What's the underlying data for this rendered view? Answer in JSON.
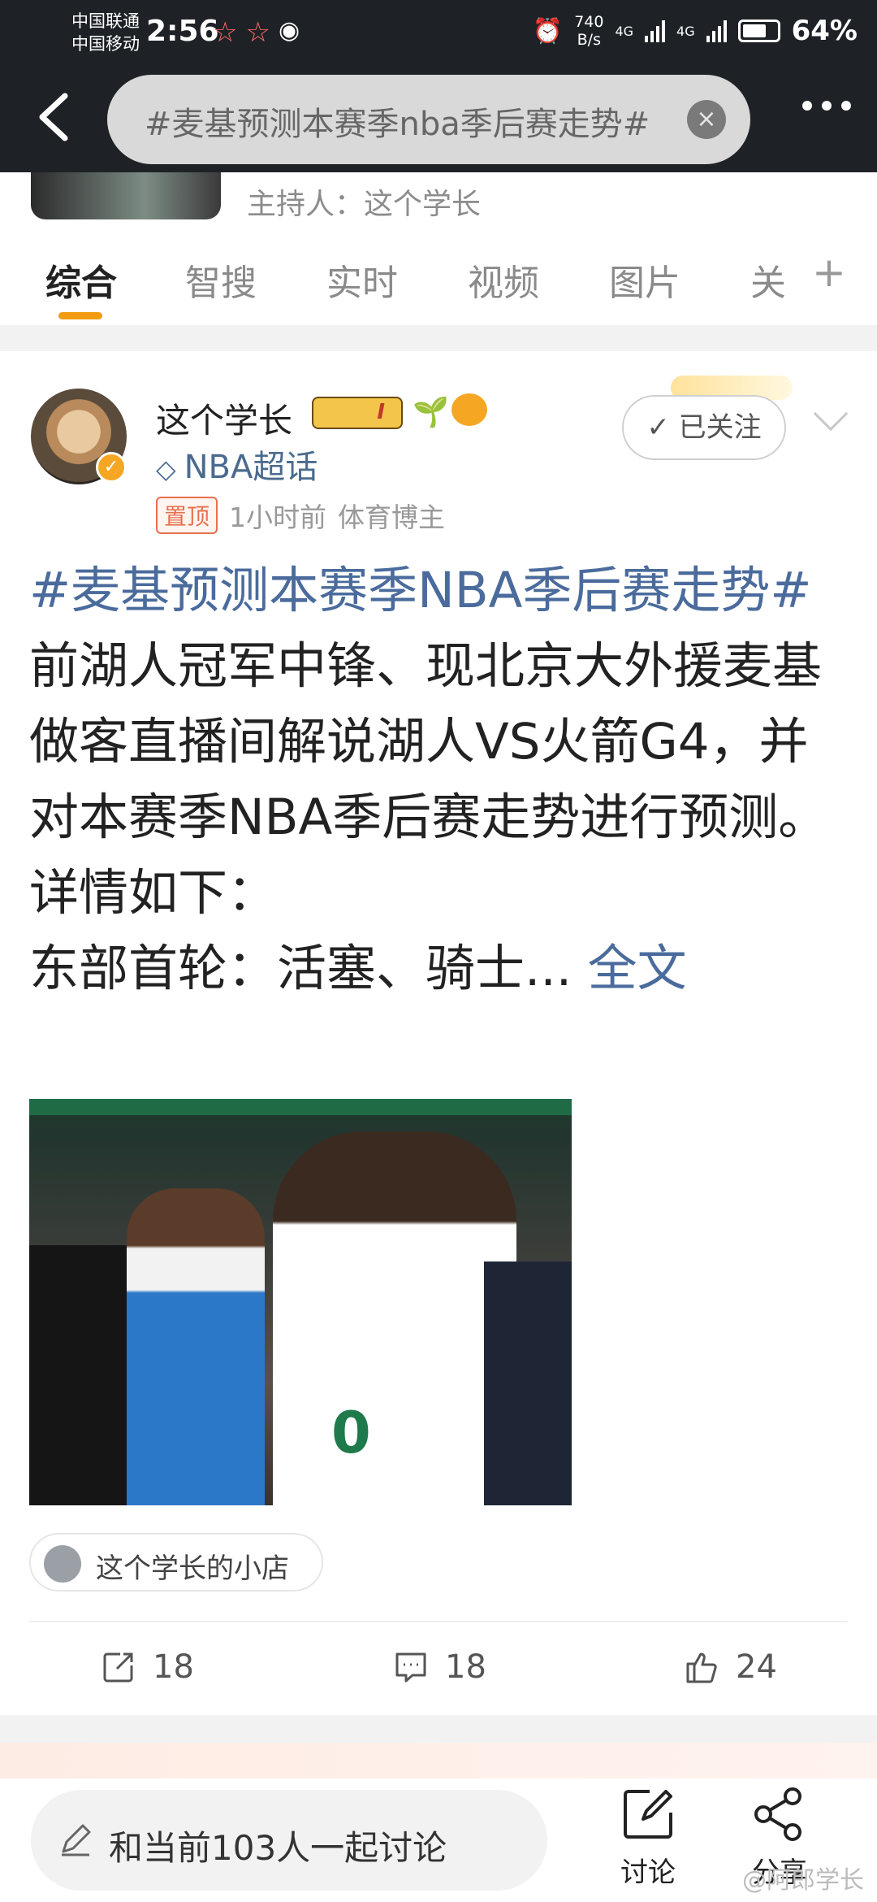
{
  "status_bar": {
    "carrier_1": "中国联通",
    "carrier_2": "中国移动",
    "time": "2:56",
    "net_speed": "740",
    "net_unit": "B/s",
    "signal_1": "4G",
    "signal_2": "4G",
    "battery": "64%"
  },
  "search": {
    "query": "#麦基预测本赛季nba季后赛走势#",
    "clear_icon": "close-icon"
  },
  "host": {
    "text": "主持人：这个学长"
  },
  "tabs": [
    {
      "label": "综合",
      "active": true
    },
    {
      "label": "智搜"
    },
    {
      "label": "实时"
    },
    {
      "label": "视频"
    },
    {
      "label": "图片"
    },
    {
      "label": "关"
    }
  ],
  "tab_add": "+",
  "post": {
    "author": "这个学长",
    "level_badge": "I",
    "supertopic": "NBA超话",
    "pinned": "置顶",
    "time": "1小时前",
    "role": "体育博主",
    "follow_label": "已关注",
    "topic": "#麦基预测本赛季NBA季后赛走势#",
    "text": " 前湖人冠军中锋、现北京大外援麦基做客直播间解说湖人VS火箭G4，并对本赛季NBA季后赛走势进行预测。",
    "line_details": "详情如下：",
    "line_east": "东部首轮：活塞、骑士...",
    "full_text_link": "全文",
    "photo_jersey_number": "0",
    "shop_label": "这个学长的小店",
    "repost_count": "18",
    "comment_count": "18",
    "like_count": "24"
  },
  "bottom_bar": {
    "discuss_placeholder": "和当前103人一起讨论",
    "discuss_btn": "讨论",
    "share_btn": "分享",
    "watermark": "@阿郎学长"
  },
  "colors": {
    "accent_orange": "#f39c12",
    "topic_blue": "#4a6b9c",
    "top_bar": "#1e2226"
  }
}
